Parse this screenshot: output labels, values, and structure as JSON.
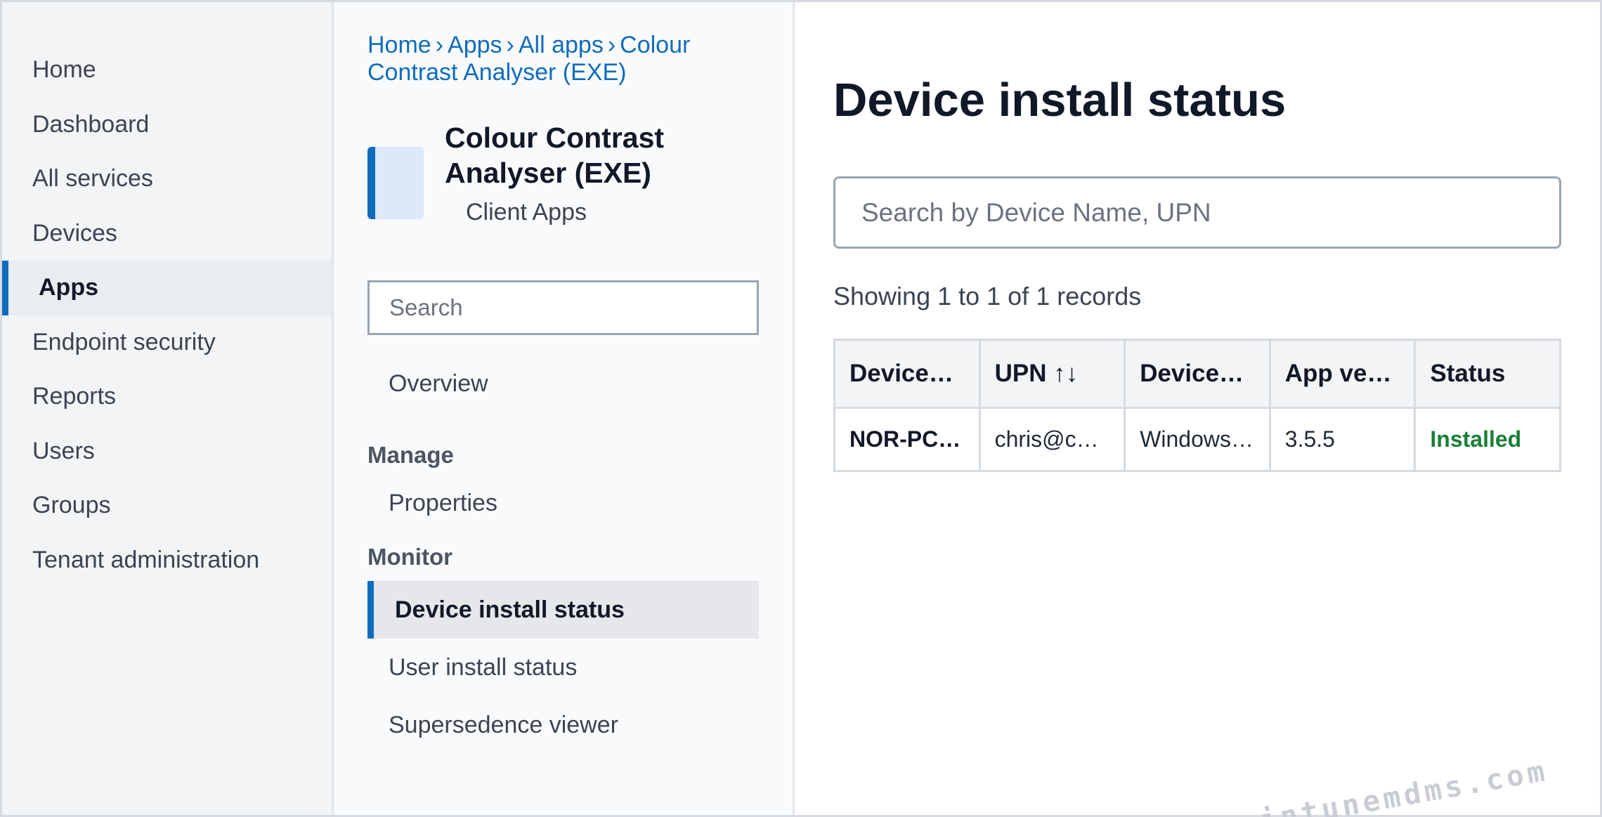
{
  "leftnav": {
    "items": [
      {
        "label": "Home",
        "active": false
      },
      {
        "label": "Dashboard",
        "active": false
      },
      {
        "label": "All services",
        "active": false
      },
      {
        "label": "Devices",
        "active": false
      },
      {
        "label": "Apps",
        "active": true
      },
      {
        "label": "Endpoint security",
        "active": false
      },
      {
        "label": "Reports",
        "active": false
      },
      {
        "label": "Users",
        "active": false
      },
      {
        "label": "Groups",
        "active": false
      },
      {
        "label": "Tenant administration",
        "active": false
      }
    ]
  },
  "breadcrumb": {
    "items": [
      "Home",
      "Apps",
      "All apps",
      "Colour Contrast Analyser (EXE)"
    ],
    "separator": "›"
  },
  "app": {
    "title": "Colour Contrast Analyser (EXE)",
    "subtitle": "Client Apps"
  },
  "blade": {
    "search_placeholder": "Search",
    "overview": "Overview",
    "manage_heading": "Manage",
    "properties": "Properties",
    "monitor_heading": "Monitor",
    "device_install_status": "Device install status",
    "user_install_status": "User install status",
    "supersedence_viewer": "Supersedence viewer"
  },
  "content": {
    "title": "Device install status",
    "search_placeholder": "Search by Device Name, UPN",
    "records": "Showing 1 to 1 of 1 records",
    "columns": [
      "Device…",
      "UPN ↑↓",
      "Device…",
      "App ve…",
      "Status"
    ],
    "rows": [
      [
        "NOR-PC…",
        "chris@c…",
        "Windows…",
        "3.5.5",
        "Installed"
      ]
    ]
  },
  "watermark": "intunemdms.com",
  "colors": {
    "accent": "#0f6cbd",
    "installed": "#1a7f37"
  }
}
